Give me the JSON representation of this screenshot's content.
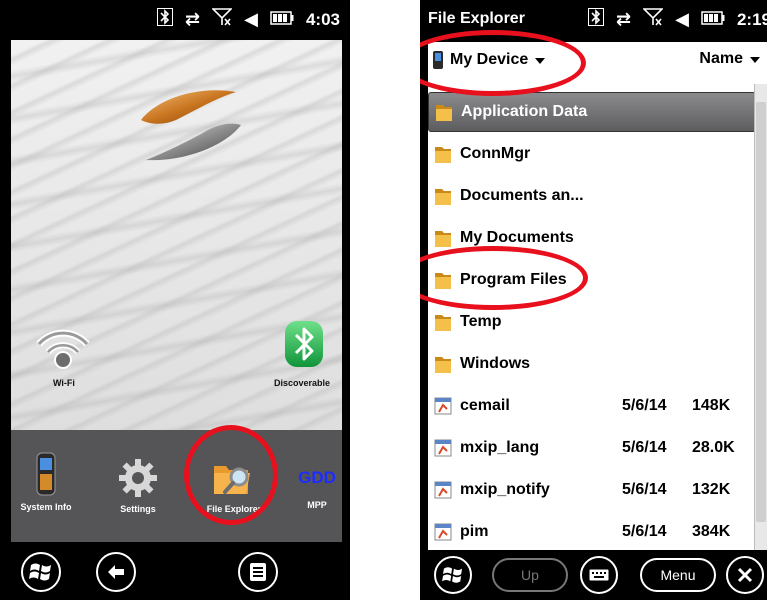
{
  "left_screen": {
    "status": {
      "time": "4:03"
    },
    "wallpaper_apps": [
      {
        "label": "Wi-Fi",
        "icon": "wifi-icon"
      },
      {
        "label": "Discoverable",
        "icon": "bluetooth-icon"
      }
    ],
    "dock_apps": [
      {
        "label": "System Info",
        "icon": "device-icon"
      },
      {
        "label": "Settings",
        "icon": "gear-icon"
      },
      {
        "label": "File Explorer",
        "icon": "folder-search-icon"
      },
      {
        "label": "MPP",
        "icon_text": "GDD"
      }
    ]
  },
  "right_screen": {
    "title": "File Explorer",
    "status": {
      "time": "2:19"
    },
    "location": "My Device",
    "sort": "Name",
    "files": [
      {
        "name": "Application Data",
        "date": "",
        "size": "",
        "type": "folder",
        "selected": true
      },
      {
        "name": "ConnMgr",
        "date": "",
        "size": "",
        "type": "folder"
      },
      {
        "name": "Documents an...",
        "date": "",
        "size": "",
        "type": "folder"
      },
      {
        "name": "My Documents",
        "date": "",
        "size": "",
        "type": "folder"
      },
      {
        "name": "Program Files",
        "date": "",
        "size": "",
        "type": "folder"
      },
      {
        "name": "Temp",
        "date": "",
        "size": "",
        "type": "folder"
      },
      {
        "name": "Windows",
        "date": "",
        "size": "",
        "type": "folder"
      },
      {
        "name": "cemail",
        "date": "5/6/14",
        "size": "148K",
        "type": "file"
      },
      {
        "name": "mxip_lang",
        "date": "5/6/14",
        "size": "28.0K",
        "type": "file"
      },
      {
        "name": "mxip_notify",
        "date": "5/6/14",
        "size": "132K",
        "type": "file"
      },
      {
        "name": "pim",
        "date": "5/6/14",
        "size": "384K",
        "type": "file"
      }
    ],
    "toolbar": {
      "up": "Up",
      "menu": "Menu"
    }
  },
  "colors": {
    "highlight_ring": "#e8101c",
    "dock_bg": "#555558",
    "mpp_blue": "#1d2cff"
  }
}
